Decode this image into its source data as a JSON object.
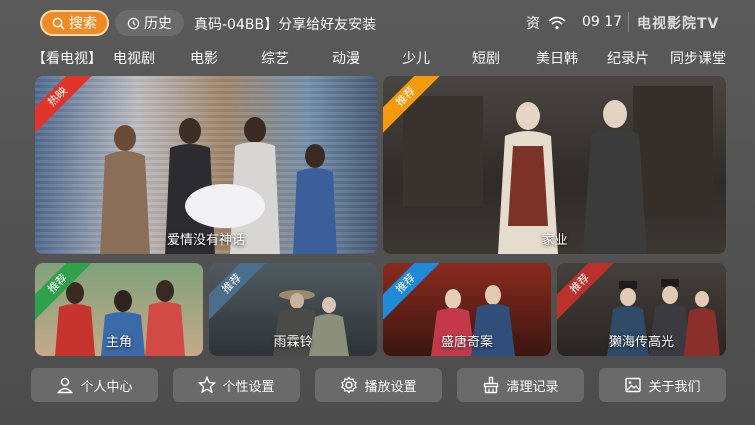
{
  "topbar": {
    "search_label": "搜索",
    "history_label": "历史",
    "marquee": "真码-04BB】分享给好友安装",
    "status_char": "资",
    "clock": "09 17",
    "brand": "电视影院TV"
  },
  "nav": {
    "items": [
      "【看电视】",
      "电视剧",
      "电影",
      "综艺",
      "动漫",
      "少儿",
      "短剧",
      "美日韩",
      "纪录片",
      "同步课堂"
    ]
  },
  "cards": [
    {
      "title": "爱情没有神话",
      "badge": "热映",
      "badge_color": "#e0342a"
    },
    {
      "title": "家业",
      "badge": "推荐",
      "badge_color": "#f59a0c"
    },
    {
      "title": "主角",
      "badge": "推荐",
      "badge_color": "#2fa14a"
    },
    {
      "title": "雨霖铃",
      "badge": "推荐",
      "badge_color": "#4a6e8c"
    },
    {
      "title": "盛唐奇案",
      "badge": "推荐",
      "badge_color": "#1f8ad8"
    },
    {
      "title": "獭海传高光",
      "badge": "推荐",
      "badge_color": "#b9322c"
    }
  ],
  "bottom": {
    "profile": "个人中心",
    "personalize": "个性设置",
    "playback": "播放设置",
    "clear": "清理记录",
    "about": "关于我们"
  },
  "colors": {
    "accent": "#f08a24",
    "button_bg": "#6a6a6a"
  }
}
